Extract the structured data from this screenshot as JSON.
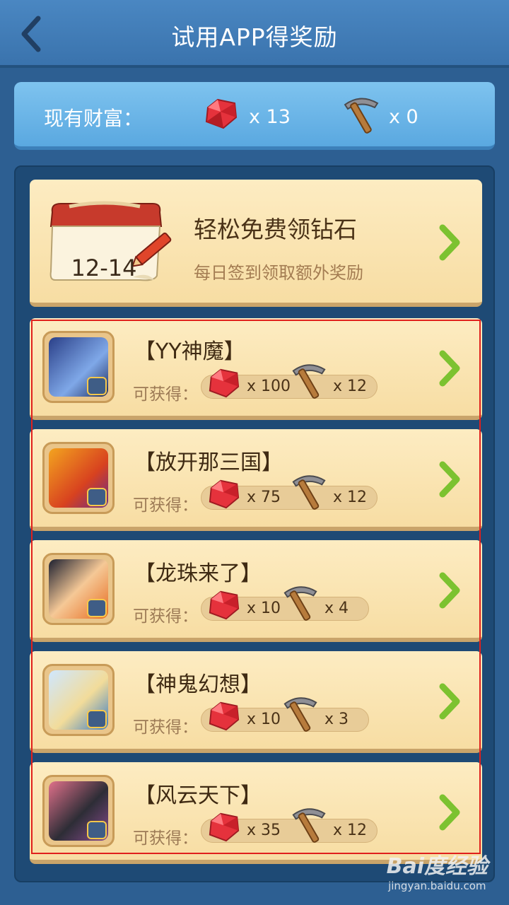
{
  "header": {
    "title": "试用APP得奖励"
  },
  "wealth": {
    "label": "现有财富：",
    "gem_count": "x 13",
    "pick_count": "x 0"
  },
  "signin": {
    "date": "12-14",
    "title": "轻松免费领钻石",
    "subtitle": "每日签到领取额外奖励"
  },
  "games": [
    {
      "title": "【YY神魔】",
      "label": "可获得：",
      "gems": "x 100",
      "picks": "x 12"
    },
    {
      "title": "【放开那三国】",
      "label": "可获得：",
      "gems": "x 75",
      "picks": "x 12"
    },
    {
      "title": "【龙珠来了】",
      "label": "可获得：",
      "gems": "x 10",
      "picks": "x 4"
    },
    {
      "title": "【神鬼幻想】",
      "label": "可获得：",
      "gems": "x 10",
      "picks": "x 3"
    },
    {
      "title": "【风云天下】",
      "label": "可获得：",
      "gems": "x 35",
      "picks": "x 12"
    }
  ],
  "watermark": {
    "main": "Bai度经验",
    "sub": "jingyan.baidu.com"
  },
  "colors": {
    "header": "#3a73ad",
    "card": "#fbe6b6",
    "chevron": "#7cc230",
    "gem": "#e5323c",
    "highlight": "#e0201c"
  }
}
